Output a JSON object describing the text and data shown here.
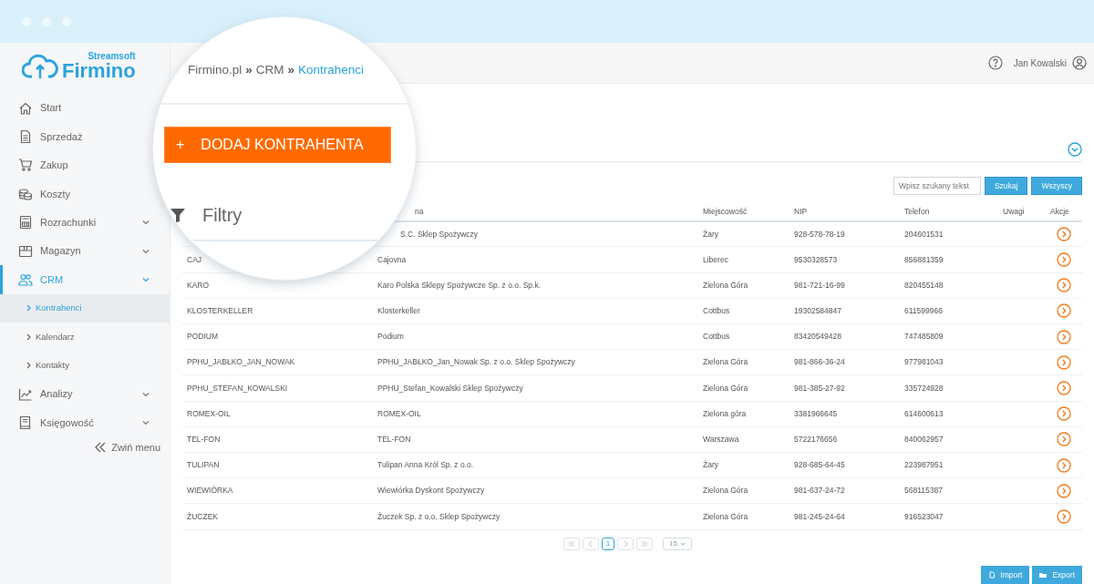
{
  "logo": {
    "brand": "Streamsoft",
    "product": "Firmino"
  },
  "sidebar": {
    "items": [
      {
        "label": "Start",
        "kind": "link",
        "selected": false
      },
      {
        "label": "Sprzedaż",
        "kind": "link",
        "selected": false
      },
      {
        "label": "Zakup",
        "kind": "link",
        "selected": false
      },
      {
        "label": "Koszty",
        "kind": "link",
        "selected": false
      },
      {
        "label": "Rozrachunki",
        "kind": "group",
        "selected": false
      },
      {
        "label": "Magazyn",
        "kind": "group",
        "selected": false
      },
      {
        "label": "CRM",
        "kind": "group",
        "selected": true,
        "children": [
          {
            "label": "Kontrahenci",
            "selected": true
          },
          {
            "label": "Kalendarz",
            "selected": false
          },
          {
            "label": "Kontakty",
            "selected": false
          }
        ]
      },
      {
        "label": "Analizy",
        "kind": "group",
        "selected": false
      },
      {
        "label": "Księgowość",
        "kind": "group",
        "selected": false
      }
    ],
    "collapse": "Zwiń menu"
  },
  "header": {
    "user": "Jan Kowalski"
  },
  "magnifier": {
    "breadcrumb": [
      {
        "label": "Firmino.pl",
        "kind": "link"
      },
      {
        "label": "»",
        "kind": "separator"
      },
      {
        "label": "CRM",
        "kind": "link"
      },
      {
        "label": "»",
        "kind": "separator"
      },
      {
        "label": "Kontrahenci",
        "kind": "current"
      }
    ],
    "add_button": {
      "icon": "+",
      "label": "DODAJ KONTRAHENTA"
    },
    "filters": "Filtry"
  },
  "search": {
    "placeholder": "Wpisz szukany tekst",
    "buttons": [
      "Szukaj",
      "Wszyscy"
    ]
  },
  "table": {
    "columns": [
      {},
      {
        "label": "na"
      },
      {
        "label": "Miejscowość"
      },
      {
        "label": "NIP"
      },
      {
        "label": "Telefon"
      },
      {
        "label": "Uwagi"
      },
      {
        "label": "Akcje"
      }
    ],
    "rows": [
      {
        "name": "S.C. Sklep Spożywczy",
        "city": "Żary",
        "nip": "928-578-78-19",
        "phone": "204601531"
      },
      {
        "code": "CAJ",
        "name": "Cajovna",
        "city": "Liberec",
        "nip": "9530328573",
        "phone": "856881359"
      },
      {
        "code": "KARO",
        "name": "Karo Polska Sklepy Spożywcze Sp. z o.o. Sp.k.",
        "city": "Zielona Góra",
        "nip": "981-721-16-99",
        "phone": "820455148"
      },
      {
        "code": "KLOSTERKELLER",
        "name": "Klosterkeller",
        "city": "Cottbus",
        "nip": "19302584847",
        "phone": "611599966"
      },
      {
        "code": "PODIUM",
        "name": "Podium",
        "city": "Cottbus",
        "nip": "83420549428",
        "phone": "747485809"
      },
      {
        "code": "PPHU_JABŁKO_JAN_NOWAK",
        "name": "PPHU_JABŁKO_Jan_Nowak Sp. z o.o. Sklep Spożywczy",
        "city": "Zielona Góra",
        "nip": "981-866-36-24",
        "phone": "977981043"
      },
      {
        "code": "PPHU_STEFAN_KOWALSKI",
        "name": "PPHU_Stefan_Kowalski Sklep Spożywczy",
        "city": "Zielona Góra",
        "nip": "981-385-27-92",
        "phone": "335724928"
      },
      {
        "code": "ROMEX-OIL",
        "name": "ROMEX-OIL",
        "city": "Zielona góra",
        "nip": "3381966645",
        "phone": "614600613"
      },
      {
        "code": "TEL-FON",
        "name": "TEL-FON",
        "city": "Warszawa",
        "nip": "5722176656",
        "phone": "840062957"
      },
      {
        "code": "TULIPAN",
        "name": "Tulipan Anna Król Sp. z o.o.",
        "city": "Żary",
        "nip": "928-685-64-45",
        "phone": "223987951"
      },
      {
        "code": "WIEWIÓRKA",
        "name": "Wiewiórka Dyskont Spożywczy",
        "city": "Zielona Góra",
        "nip": "981-637-24-72",
        "phone": "568115387"
      },
      {
        "code": "ŻUCZEK",
        "name": "Żuczek Sp. z o.o. Sklep Spożywczy",
        "city": "Zielona Góra",
        "nip": "981-245-24-64",
        "phone": "916523047"
      }
    ]
  },
  "pagination": {
    "pages": [
      {
        "label": "1",
        "selected": true
      }
    ],
    "page_size": "15"
  },
  "footer_buttons": [
    {
      "label": "Import"
    },
    {
      "label": "Export"
    }
  ]
}
